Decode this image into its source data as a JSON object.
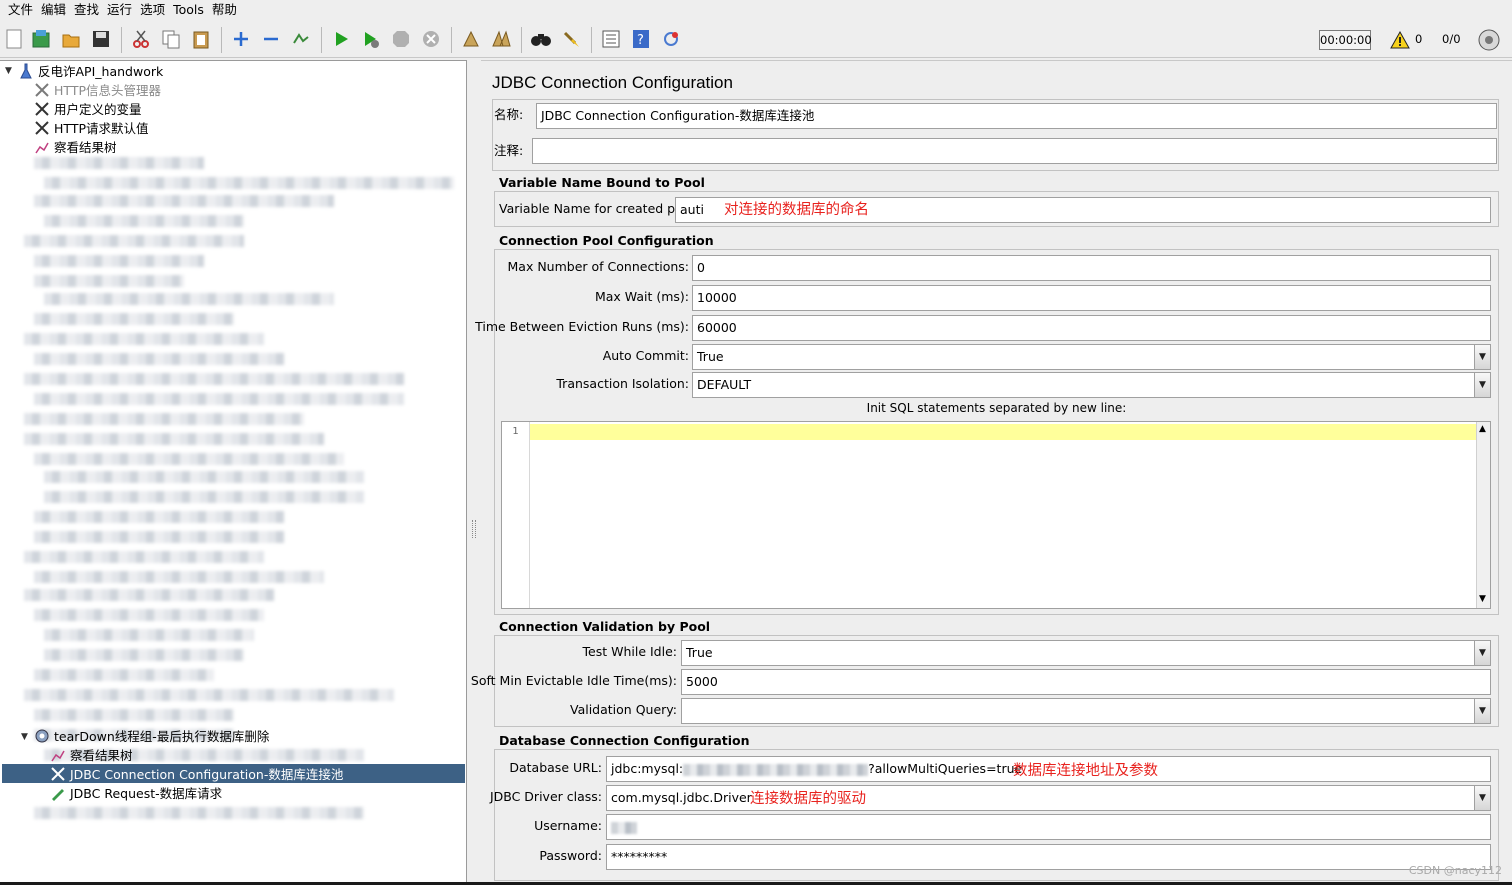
{
  "menu": [
    "文件",
    "编辑",
    "查找",
    "运行",
    "选项",
    "Tools",
    "帮助"
  ],
  "toolbar": {
    "timer": "00:00:00",
    "warning_count": "0",
    "thread_ratio": "0/0"
  },
  "tree": {
    "root": "反电诈API_handwork",
    "children": [
      "HTTP信息头管理器",
      "用户定义的变量",
      "HTTP请求默认值",
      "察看结果树"
    ],
    "teardown": "tearDown线程组-最后执行数据库删除",
    "teardown_children": [
      "察看结果树",
      "JDBC Connection Configuration-数据库连接池",
      "JDBC Request-数据库请求"
    ]
  },
  "panel": {
    "title": "JDBC Connection Configuration",
    "name_label": "名称:",
    "name_value": "JDBC Connection Configuration-数据库连接池",
    "comment_label": "注释:",
    "comment_value": ""
  },
  "var_section": {
    "title": "Variable Name Bound to Pool",
    "label": "Variable Name for created pool:",
    "value": "auti",
    "annotation": "对连接的数据库的命名"
  },
  "pool_section": {
    "title": "Connection Pool Configuration",
    "max_conn_label": "Max Number of Connections:",
    "max_conn_value": "0",
    "max_wait_label": "Max Wait (ms):",
    "max_wait_value": "10000",
    "eviction_label": "Time Between Eviction Runs (ms):",
    "eviction_value": "60000",
    "auto_commit_label": "Auto Commit:",
    "auto_commit_value": "True",
    "isolation_label": "Transaction Isolation:",
    "isolation_value": "DEFAULT",
    "init_sql_label": "Init SQL statements separated by new line:",
    "line_number": "1"
  },
  "validation_section": {
    "title": "Connection Validation by Pool",
    "idle_label": "Test While Idle:",
    "idle_value": "True",
    "soft_min_label": "Soft Min Evictable Idle Time(ms):",
    "soft_min_value": "5000",
    "query_label": "Validation Query:",
    "query_value": ""
  },
  "db_section": {
    "title": "Database Connection Configuration",
    "url_label": "Database URL:",
    "url_prefix": "jdbc:mysql:",
    "url_suffix": "?allowMultiQueries=true",
    "url_annotation": "数据库连接地址及参数",
    "driver_label": "JDBC Driver class:",
    "driver_value": "com.mysql.jdbc.Driver",
    "driver_annotation": "连接数据库的驱动",
    "user_label": "Username:",
    "password_label": "Password:",
    "password_value": "*********"
  },
  "watermark": "CSDN @nacy112",
  "colors": {
    "selection": "#3d6185",
    "annotation": "#e8231f",
    "sql_highlight": "#ffff9b"
  }
}
